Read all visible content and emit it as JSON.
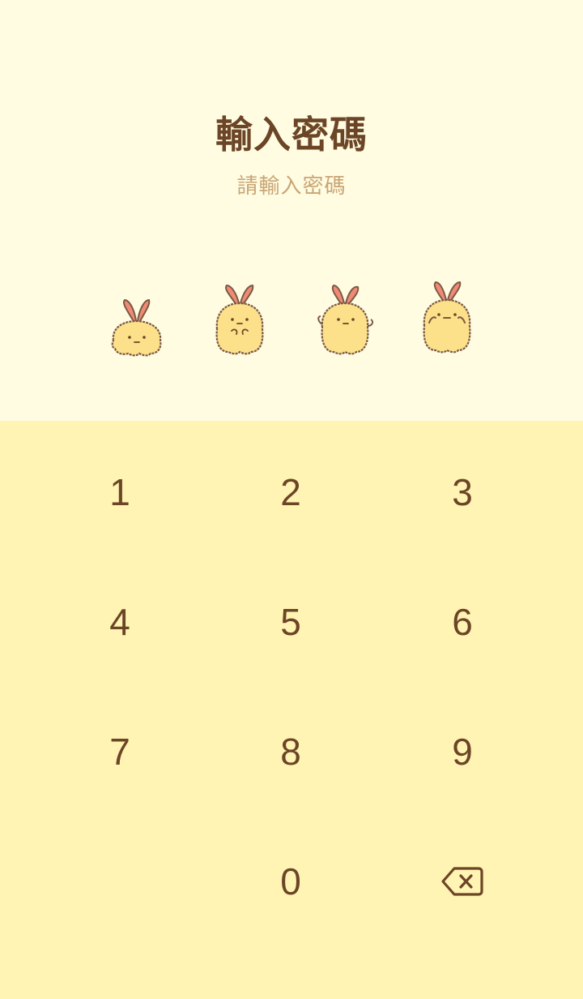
{
  "header": {
    "title": "輸入密碼",
    "subtitle": "請輸入密碼"
  },
  "pin_indicators": [
    {
      "icon": "fried-shrimp-sitting-icon",
      "filled": false
    },
    {
      "icon": "fried-shrimp-hugging-icon",
      "filled": false
    },
    {
      "icon": "fried-shrimp-waving-icon",
      "filled": false
    },
    {
      "icon": "fried-shrimp-standing-icon",
      "filled": false
    }
  ],
  "keypad": {
    "keys": [
      "1",
      "2",
      "3",
      "4",
      "5",
      "6",
      "7",
      "8",
      "9",
      "0"
    ],
    "backspace_icon": "backspace-icon"
  },
  "colors": {
    "top_background": "#FFFCE2",
    "keypad_background": "#FFF4B3",
    "text_primary": "#6B4526",
    "text_secondary": "#C9A575",
    "shrimp_body": "#FDE08A",
    "shrimp_tail": "#F08A74",
    "outline": "#7A5A45"
  }
}
